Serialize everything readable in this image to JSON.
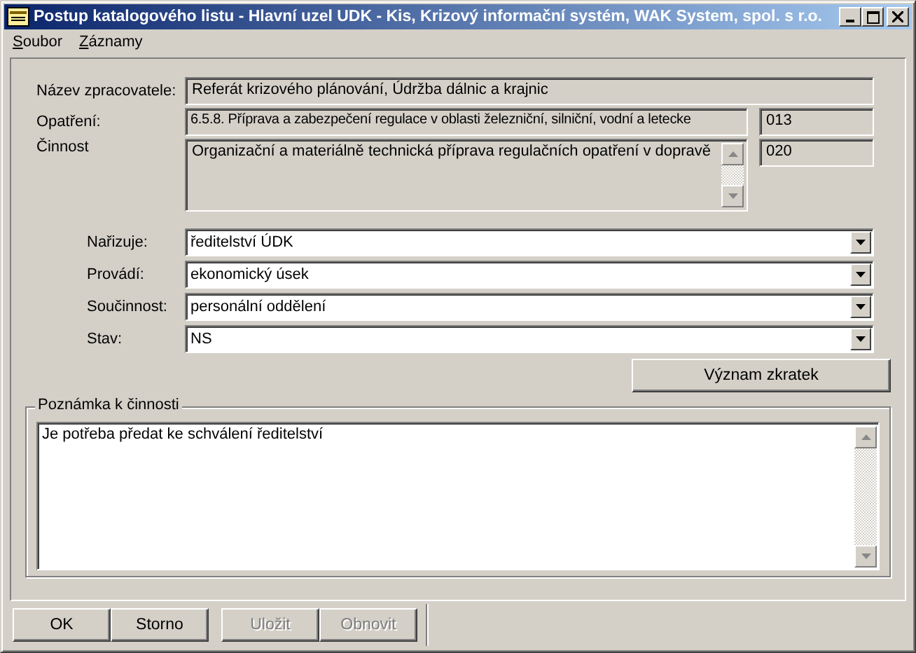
{
  "window": {
    "title": "Postup katalogového listu - Hlavní uzel UDK - Kis, Krizový informační systém, WAK System, spol. s r.o."
  },
  "menu": [
    {
      "label": "Soubor"
    },
    {
      "label": "Záznamy"
    }
  ],
  "header_fields": {
    "processor": {
      "label": "Název zpracovatele:",
      "value": "Referát krizového plánování, Údržba dálnic a krajnic"
    },
    "measure": {
      "label": "Opatření:",
      "value": "6.5.8. Příprava a zabezpečení regulace v oblasti železniční, silniční, vodní a letecke",
      "code": "013"
    },
    "activity": {
      "label": "Činnost",
      "value": "Organizační a materiálně technická příprava regulačních opatření v dopravě",
      "code": "020"
    }
  },
  "combos": [
    {
      "label": "Nařizuje:",
      "value": "ředitelství ÚDK"
    },
    {
      "label": "Provádí:",
      "value": "ekonomický úsek"
    },
    {
      "label": "Součinnost:",
      "value": "personální oddělení"
    },
    {
      "label": "Stav:",
      "value": "NS"
    }
  ],
  "legend_button": "Význam zkratek",
  "note": {
    "title": "Poznámka k činnosti",
    "value": "Je potřeba předat ke schválení ředitelství"
  },
  "buttons": [
    {
      "label": "OK",
      "disabled": false
    },
    {
      "label": "Storno",
      "disabled": false
    },
    {
      "label": "Uložit",
      "disabled": true
    },
    {
      "label": "Obnovit",
      "disabled": true
    }
  ]
}
